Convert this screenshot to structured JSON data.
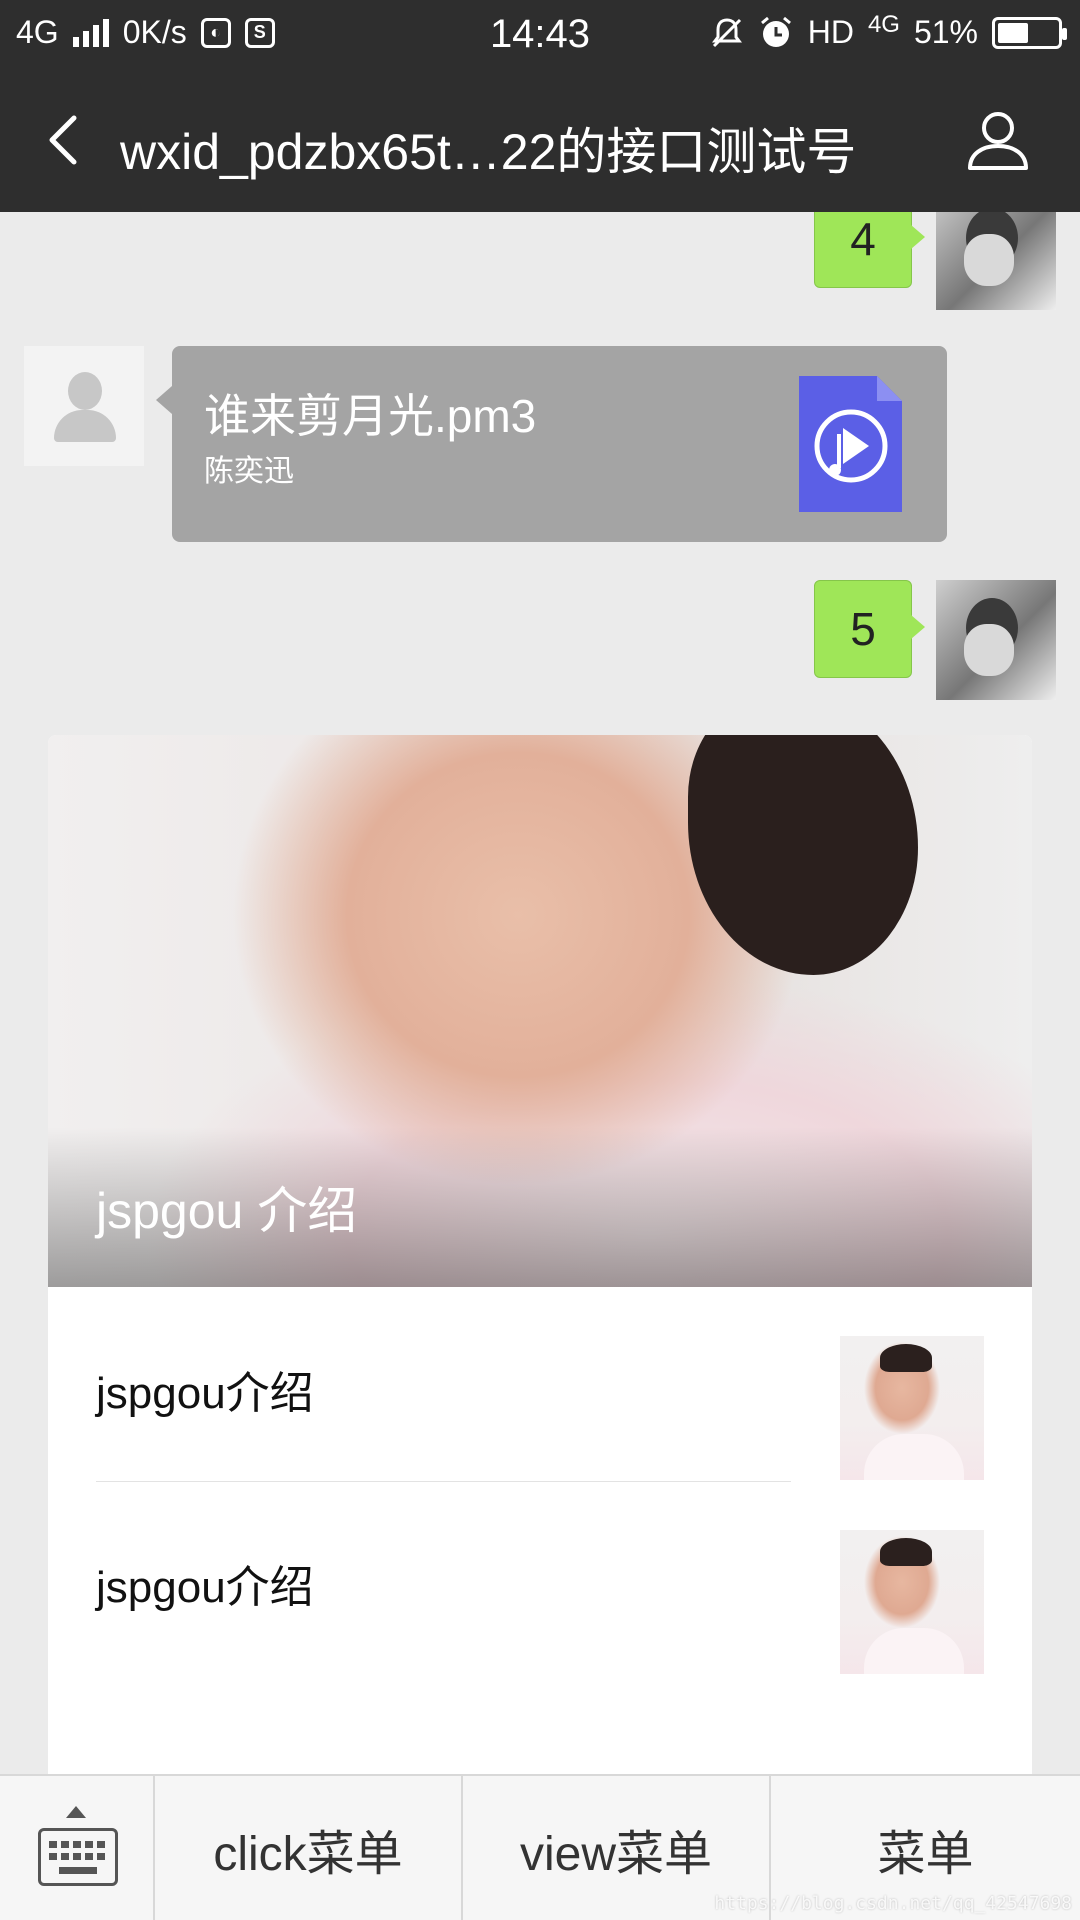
{
  "status_bar": {
    "network": "4G",
    "speed": "0K/s",
    "time": "14:43",
    "hd_label": "HD",
    "network_right": "4G",
    "battery": "51%",
    "battery_level": 0.51
  },
  "header": {
    "title": "wxid_pdzbx65t…22的接口测试号"
  },
  "messages": {
    "sent_1": "4",
    "music": {
      "title": "谁来剪月光.pm3",
      "artist": "陈奕迅"
    },
    "sent_2": "5"
  },
  "news_card": {
    "cover_title": "jspgou 介绍",
    "articles": [
      {
        "title": "jspgou介绍"
      },
      {
        "title": "jspgou介绍"
      }
    ]
  },
  "menu_bar": {
    "items": [
      "click菜单",
      "view菜单",
      "菜单"
    ]
  },
  "watermark": "https://blog.csdn.net/qq_42547698",
  "colors": {
    "header_bg": "#2e2e2e",
    "chat_bg": "#ebebeb",
    "sent_bubble": "#9fe658",
    "music_bubble": "#a4a4a4",
    "music_icon": "#5b5fe6"
  },
  "icons": [
    "signal-icon",
    "app-icon",
    "sim-icon",
    "mute-icon",
    "alarm-icon",
    "battery-icon",
    "back-icon",
    "profile-icon",
    "music-file-icon",
    "keyboard-icon"
  ]
}
